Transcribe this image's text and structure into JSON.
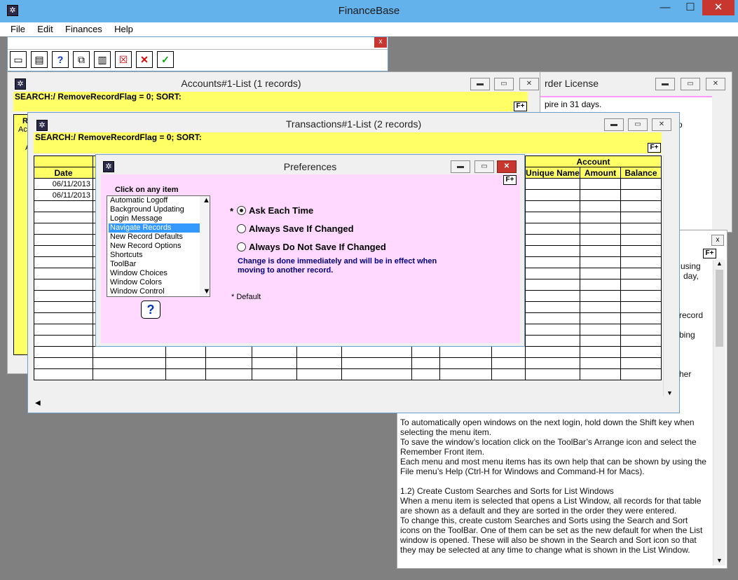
{
  "app": {
    "title": "FinanceBase"
  },
  "menu": [
    "File",
    "Edit",
    "Finances",
    "Help"
  ],
  "toolbar_window": {
    "close": "x"
  },
  "accounts": {
    "title": "Accounts#1-List (1 records)",
    "search": "SEARCH:/ RemoveRecordFlag = 0; SORT:",
    "fplus": "F+",
    "partial_header": "R",
    "partial_sub": "Ac",
    "partial_a": "A"
  },
  "license": {
    "title": "rder License",
    "line1": "pire in 31 days.",
    "line2": "o"
  },
  "help": {
    "close": "x",
    "fplus": "F+",
    "frag1": "n using",
    "frag2": "day,",
    "frag3": "record",
    "frag4": "bing",
    "frag5": "her",
    "paragraphs": [
      "  To automatically open windows on the next login, hold down the Shift key when selecting the menu item.",
      "  To save the window’s location click on the ToolBar’s Arrange icon and select the Remember Front item.",
      "  Each menu and most menu items has its own help that can be shown by using the File menu’s Help (Ctrl-H for Windows and Command-H for Macs).",
      "1.2) Create Custom Searches and Sorts for List Windows",
      "  When a menu item is selected that opens a List Window, all records for that table are shown as a default and they are sorted in the order they were entered.",
      "  To change this, create custom Searches and Sorts using the Search and Sort icons on the ToolBar. One of them can be set as the new default for when the List window is opened. These will also be shown in the Search and Sort icon so that they may be selected at any time to change what is shown in the List Window."
    ]
  },
  "transactions": {
    "title": "Transactions#1-List (2 records)",
    "search": "SEARCH:/ RemoveRecordFlag = 0; SORT:",
    "fplus": "F+",
    "col_date": "Date",
    "group_account": "Account",
    "col_unique": "Unique Name",
    "col_amount": "Amount",
    "col_balance": "Balance",
    "rows": [
      "06/11/2013",
      "06/11/2013"
    ]
  },
  "preferences": {
    "title": "Preferences",
    "fplus": "F+",
    "list_label": "Click on any item",
    "items": [
      "Automatic Logoff",
      "Background Updating",
      "Login Message",
      "Navigate Records",
      "New Record Defaults",
      "New Record Options",
      "Shortcuts",
      "ToolBar",
      "Window Choices",
      "Window Colors",
      "Window Control"
    ],
    "selected_index": 3,
    "help_btn": "?",
    "star": "*",
    "options": [
      "Ask Each Time",
      "Always Save If Changed",
      "Always Do Not Save If Changed"
    ],
    "selected_option": 0,
    "note": "Change is done immediately and will be in effect when moving to another record.",
    "default_note": "* Default"
  },
  "colors": {
    "titlebar": "#63b2eb",
    "yellow": "#ffff66",
    "pink": "#ffd9ff",
    "navy": "#000080"
  }
}
